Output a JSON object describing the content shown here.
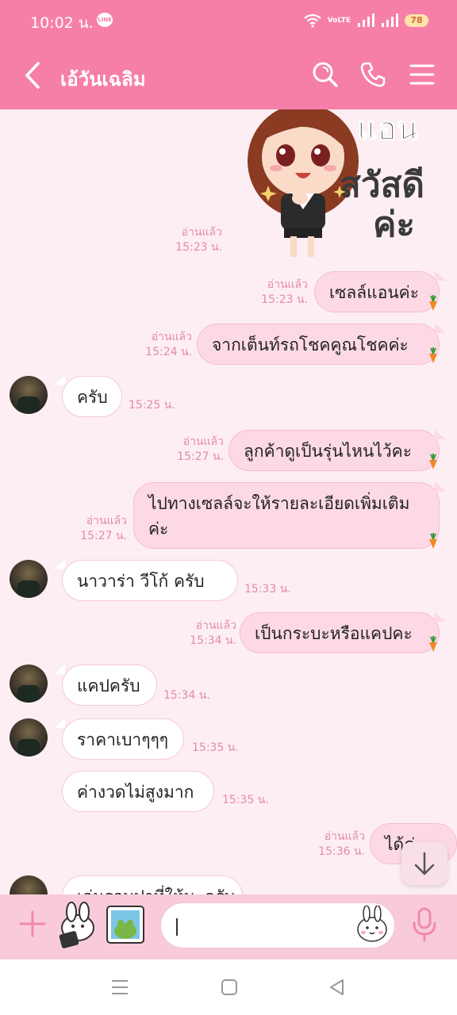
{
  "status_bar": {
    "time": "10:02 น.",
    "app_badge": "LINE",
    "volte": "VoLTE",
    "battery": "78"
  },
  "header": {
    "title": "เอ้วันเฉลิม",
    "icons": [
      "back-icon",
      "search-icon",
      "phone-icon",
      "menu-icon"
    ]
  },
  "sticker": {
    "text_top": "แอน",
    "text_main": "สวัสดี",
    "text_bottom": "ค่ะ",
    "read": "อ่านแล้ว",
    "time": "15:23 น."
  },
  "messages": [
    {
      "dir": "out",
      "text": "เซลล์แอนค่ะ",
      "read": "อ่านแล้ว",
      "time": "15:23 น."
    },
    {
      "dir": "out",
      "text": "จากเต็นท์รถโชคคูณโชคค่ะ",
      "read": "อ่านแล้ว",
      "time": "15:24 น."
    },
    {
      "dir": "in",
      "text": "ครับ",
      "time": "15:25 น."
    },
    {
      "dir": "out",
      "text": "ลูกค้าดูเป็นรุ่นไหนไว้คะ",
      "read": "อ่านแล้ว",
      "time": "15:27 น."
    },
    {
      "dir": "out",
      "text": "ไปทางเซลล์จะให้รายละเอียดเพิ่มเติมค่ะ",
      "read": "อ่านแล้ว",
      "time": "15:27 น."
    },
    {
      "dir": "in",
      "text": "นาวาร่า  วีโก้  ครับ",
      "time": "15:33 น."
    },
    {
      "dir": "out",
      "text": "เป็นกระบะหรือแคปคะ",
      "read": "อ่านแล้ว",
      "time": "15:34 น."
    },
    {
      "dir": "in",
      "text": "แคปครับ",
      "time": "15:34 น."
    },
    {
      "dir": "in",
      "text": "ราคาเบาๆๆๆ",
      "time": "15:35 น."
    },
    {
      "dir": "in",
      "text": "ค่างวดไม่สูงมาก",
      "time": "15:35 น."
    },
    {
      "dir": "out",
      "text": "ได้ค่ะ",
      "read": "อ่านแล้ว",
      "time": "15:36 น."
    },
    {
      "dir": "in",
      "text": "เล่นรอบปาที่ให้นะครับ",
      "time": ""
    }
  ],
  "input": {
    "placeholder": "",
    "value": ""
  },
  "nav": {
    "icons": [
      "recent-apps-icon",
      "home-icon",
      "back-nav-icon"
    ]
  },
  "colors": {
    "header": "#f67fa9",
    "background": "#fdeef3",
    "bubble_out": "#fcd9e5",
    "bubble_in": "#ffffff",
    "meta": "#e48aab"
  }
}
